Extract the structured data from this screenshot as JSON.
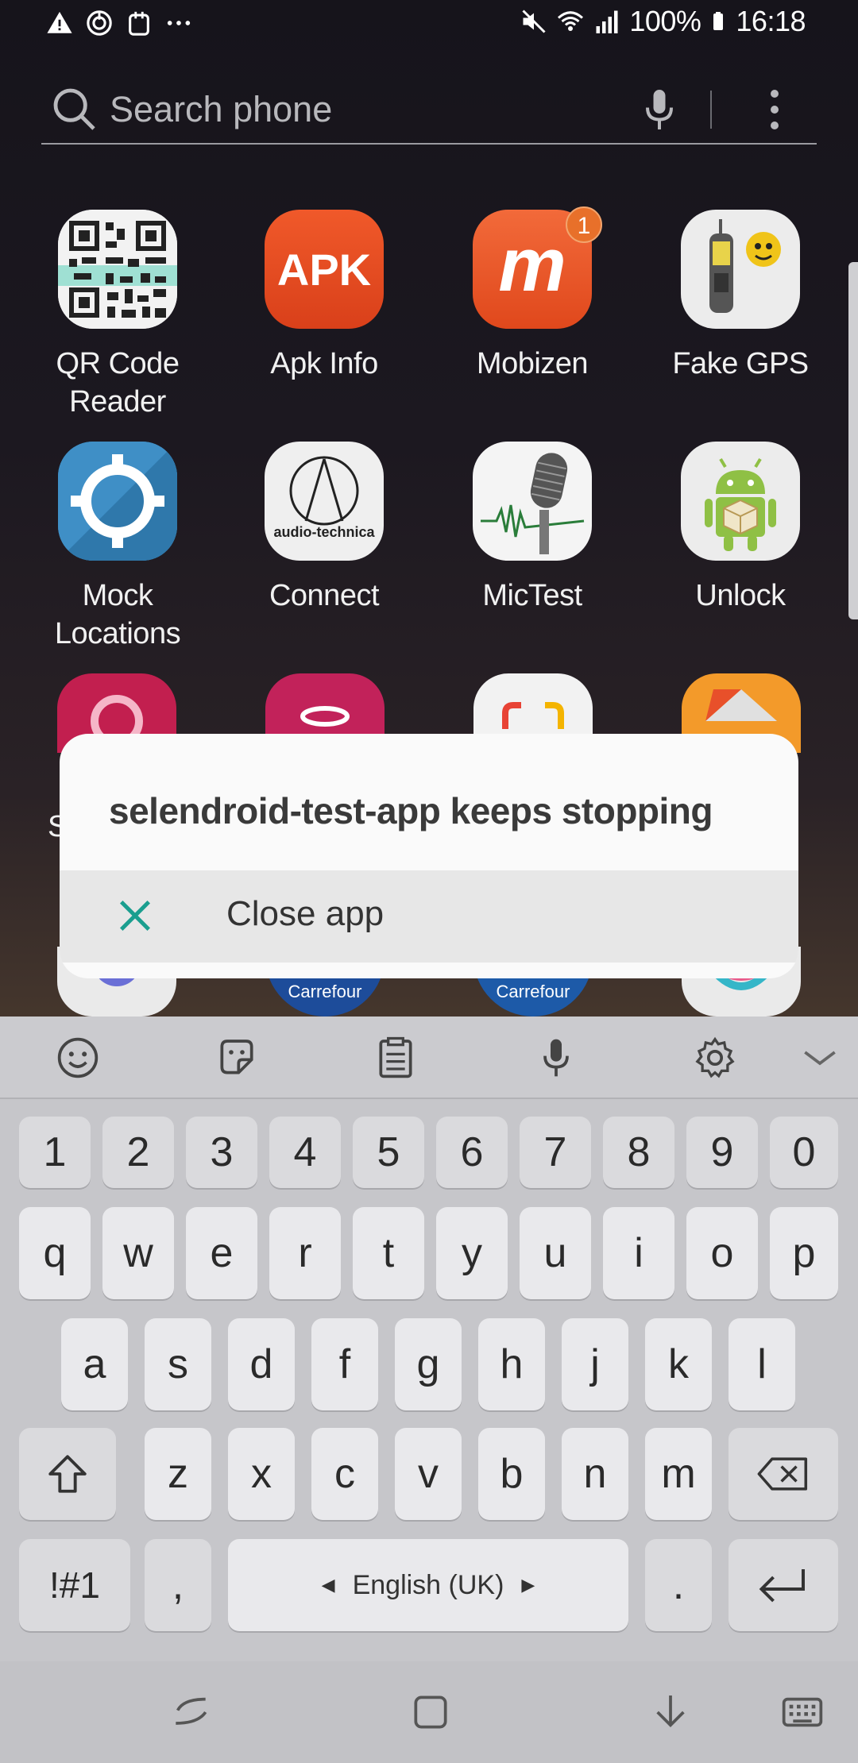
{
  "status_bar": {
    "battery": "100%",
    "time": "16:18",
    "left_icons": [
      "warning-icon",
      "sync-icon",
      "clipboard-icon",
      "more-dots-icon"
    ],
    "right_icons": [
      "mute-icon",
      "wifi-icon",
      "signal-icon",
      "battery-icon"
    ]
  },
  "search": {
    "placeholder": "Search phone"
  },
  "apps": [
    {
      "label": "QR Code Reader",
      "icon": "qr-code-icon"
    },
    {
      "label": "Apk Info",
      "icon": "apk-icon",
      "icon_text": "APK"
    },
    {
      "label": "Mobizen",
      "icon": "mobizen-icon",
      "badge": "1",
      "icon_text": "m"
    },
    {
      "label": "Fake GPS",
      "icon": "gps-device-icon"
    },
    {
      "label": "Mock Locations",
      "icon": "crosshair-icon"
    },
    {
      "label": "Connect",
      "icon": "audio-technica-icon",
      "icon_text": "audio-technica"
    },
    {
      "label": "MicTest",
      "icon": "microphone-icon"
    },
    {
      "label": "Unlock",
      "icon": "android-icon"
    }
  ],
  "partial_apps_row4": [
    "Carrefour",
    "Carrefour"
  ],
  "partial_apps_row4_label": "S",
  "dialog": {
    "title": "selendroid-test-app keeps stopping",
    "action_label": "Close app",
    "colors": {
      "accent": "#1a9e8f"
    }
  },
  "keyboard": {
    "toolbar_icons": [
      "emoji-icon",
      "sticker-icon",
      "clipboard-icon",
      "voice-input-icon",
      "settings-icon",
      "collapse-icon"
    ],
    "row_numbers": [
      "1",
      "2",
      "3",
      "4",
      "5",
      "6",
      "7",
      "8",
      "9",
      "0"
    ],
    "row1": [
      "q",
      "w",
      "e",
      "r",
      "t",
      "y",
      "u",
      "i",
      "o",
      "p"
    ],
    "row2": [
      "a",
      "s",
      "d",
      "f",
      "g",
      "h",
      "j",
      "k",
      "l"
    ],
    "row3": [
      "z",
      "x",
      "c",
      "v",
      "b",
      "n",
      "m"
    ],
    "symbols_key": "!#1",
    "comma_key": ",",
    "space_label": "English (UK)",
    "period_key": "."
  },
  "navbar": {
    "icons": [
      "back-icon",
      "home-icon",
      "hide-keyboard-icon",
      "keyboard-switch-icon"
    ]
  }
}
